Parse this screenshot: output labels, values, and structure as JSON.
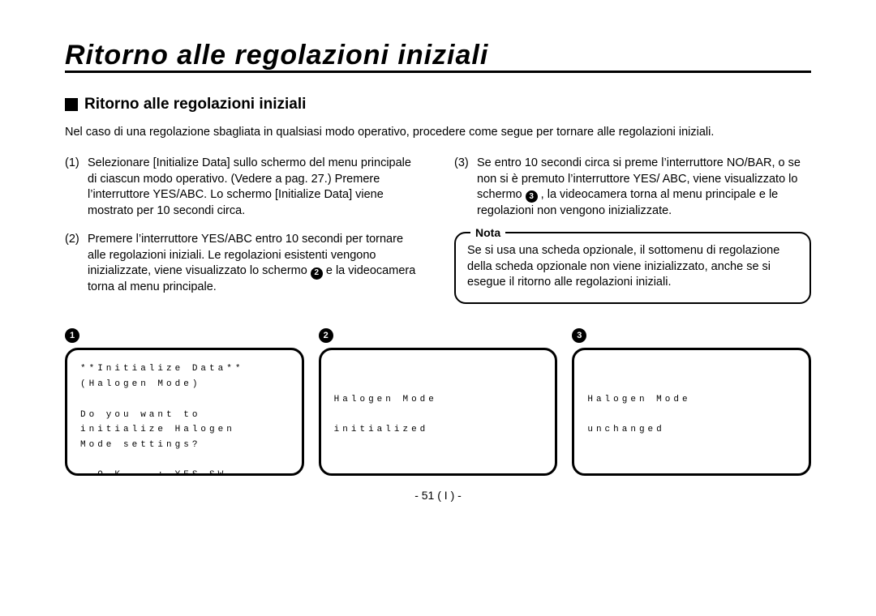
{
  "title": "Ritorno alle regolazioni iniziali",
  "subtitle": "Ritorno alle regolazioni iniziali",
  "intro": "Nel caso di una regolazione sbagliata in qualsiasi modo operativo, procedere come segue per tornare alle regolazioni iniziali.",
  "steps": {
    "s1_num": "(1)",
    "s1_body": "Selezionare [Initialize Data] sullo schermo del menu principale di ciascun modo operativo. (Vedere a pag. 27.) Premere l’interruttore YES/ABC. Lo schermo [Initialize Data] viene mostrato per 10 secondi circa.",
    "s2_num": "(2)",
    "s2_pre": "Premere l’interruttore YES/ABC entro 10 secondi per tornare alle regolazioni iniziali. Le regolazioni esistenti vengono inizializzate, viene visualizzato lo schermo ",
    "s2_circ": "2",
    "s2_post": " e la videocamera torna al menu principale.",
    "s3_num": "(3)",
    "s3_pre": "Se entro 10 secondi circa si preme l’interruttore NO/BAR, o se non si è premuto l’interruttore YES/ ABC, viene visualizzato lo schermo ",
    "s3_circ": "3",
    "s3_post": ", la videocamera torna al menu principale e le regolazioni non vengono inizializzate."
  },
  "nota": {
    "label": "Nota",
    "body": "Se si usa una scheda opzionale, il sottomenu di regolazione della scheda opzionale non viene inizializzato, anche se si esegue il ritorno alle regolazioni iniziali."
  },
  "screens": {
    "n1": "1",
    "n2": "2",
    "n3": "3",
    "scr1": "**Initialize Data**\n(Halogen Mode)\n\nDo you want to\ninitialize Halogen\nMode settings?\n\n  O.K.   : YES SW\n  Cancel : NO SW",
    "scr2": "\n\nHalogen Mode\n\ninitialized",
    "scr3": "\n\nHalogen Mode\n\nunchanged"
  },
  "pagenum": "- 51 ( I ) -"
}
